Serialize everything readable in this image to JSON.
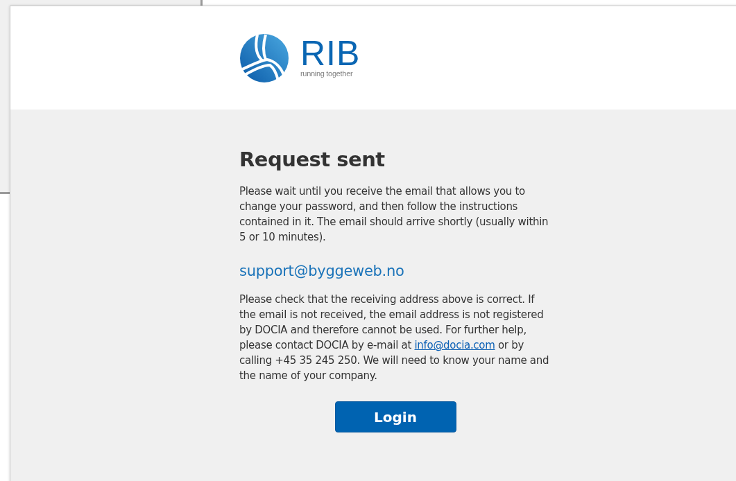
{
  "logo": {
    "name": "RIB",
    "tagline": "running together"
  },
  "title": "Request sent",
  "intro": "Please wait until you receive the email that allows you to change your password, and then follow the instructions contained in it. The email should arrive shortly (usually within 5 or 10 minutes).",
  "email": "support@byggeweb.no",
  "help": {
    "before": "Please check that the receiving address above is correct. If the email is not received, the email address is not registered by DOCIA and therefore cannot be used. For further help, please contact DOCIA by e-mail at ",
    "link": "info@docia.com",
    "after": " or by calling +45 35 245 250. We will need to know your name and the name of your company."
  },
  "button": "Login"
}
